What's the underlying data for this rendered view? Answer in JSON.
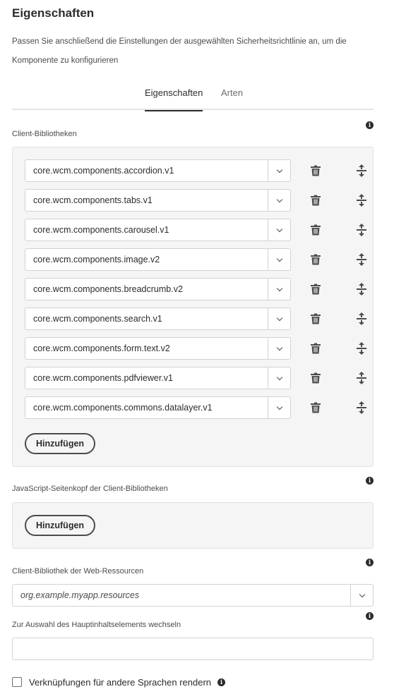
{
  "header": {
    "title": "Eigenschaften",
    "description": "Passen Sie anschließend die Einstellungen der ausgewählten Sicherheitsrichtlinie an, um die Komponente zu konfigurieren"
  },
  "tabs": [
    {
      "label": "Eigenschaften",
      "active": true
    },
    {
      "label": "Arten",
      "active": false
    }
  ],
  "client_libraries": {
    "label": "Client-Bibliotheken",
    "items": [
      "core.wcm.components.accordion.v1",
      "core.wcm.components.tabs.v1",
      "core.wcm.components.carousel.v1",
      "core.wcm.components.image.v2",
      "core.wcm.components.breadcrumb.v2",
      "core.wcm.components.search.v1",
      "core.wcm.components.form.text.v2",
      "core.wcm.components.pdfviewer.v1",
      "core.wcm.components.commons.datalayer.v1"
    ],
    "add_label": "Hinzufügen"
  },
  "js_head_libraries": {
    "label": "JavaScript-Seitenkopf der Client-Bibliotheken",
    "add_label": "Hinzufügen"
  },
  "web_resources": {
    "label": "Client-Bibliothek der Web-Ressourcen",
    "value": "org.example.myapp.resources"
  },
  "main_content": {
    "label": "Zur Auswahl des Hauptinhaltselements wechseln",
    "value": ""
  },
  "render_links": {
    "label": "Verknüpfungen für andere Sprachen rendern",
    "checked": false
  },
  "icons": {
    "info": "info-icon",
    "delete": "trash-icon",
    "reorder": "move-vertical-icon",
    "dropdown": "chevron-down-icon"
  },
  "colors": {
    "text": "#2c2c2c",
    "panel_bg": "#f5f5f5",
    "border": "#d2d2d2"
  }
}
